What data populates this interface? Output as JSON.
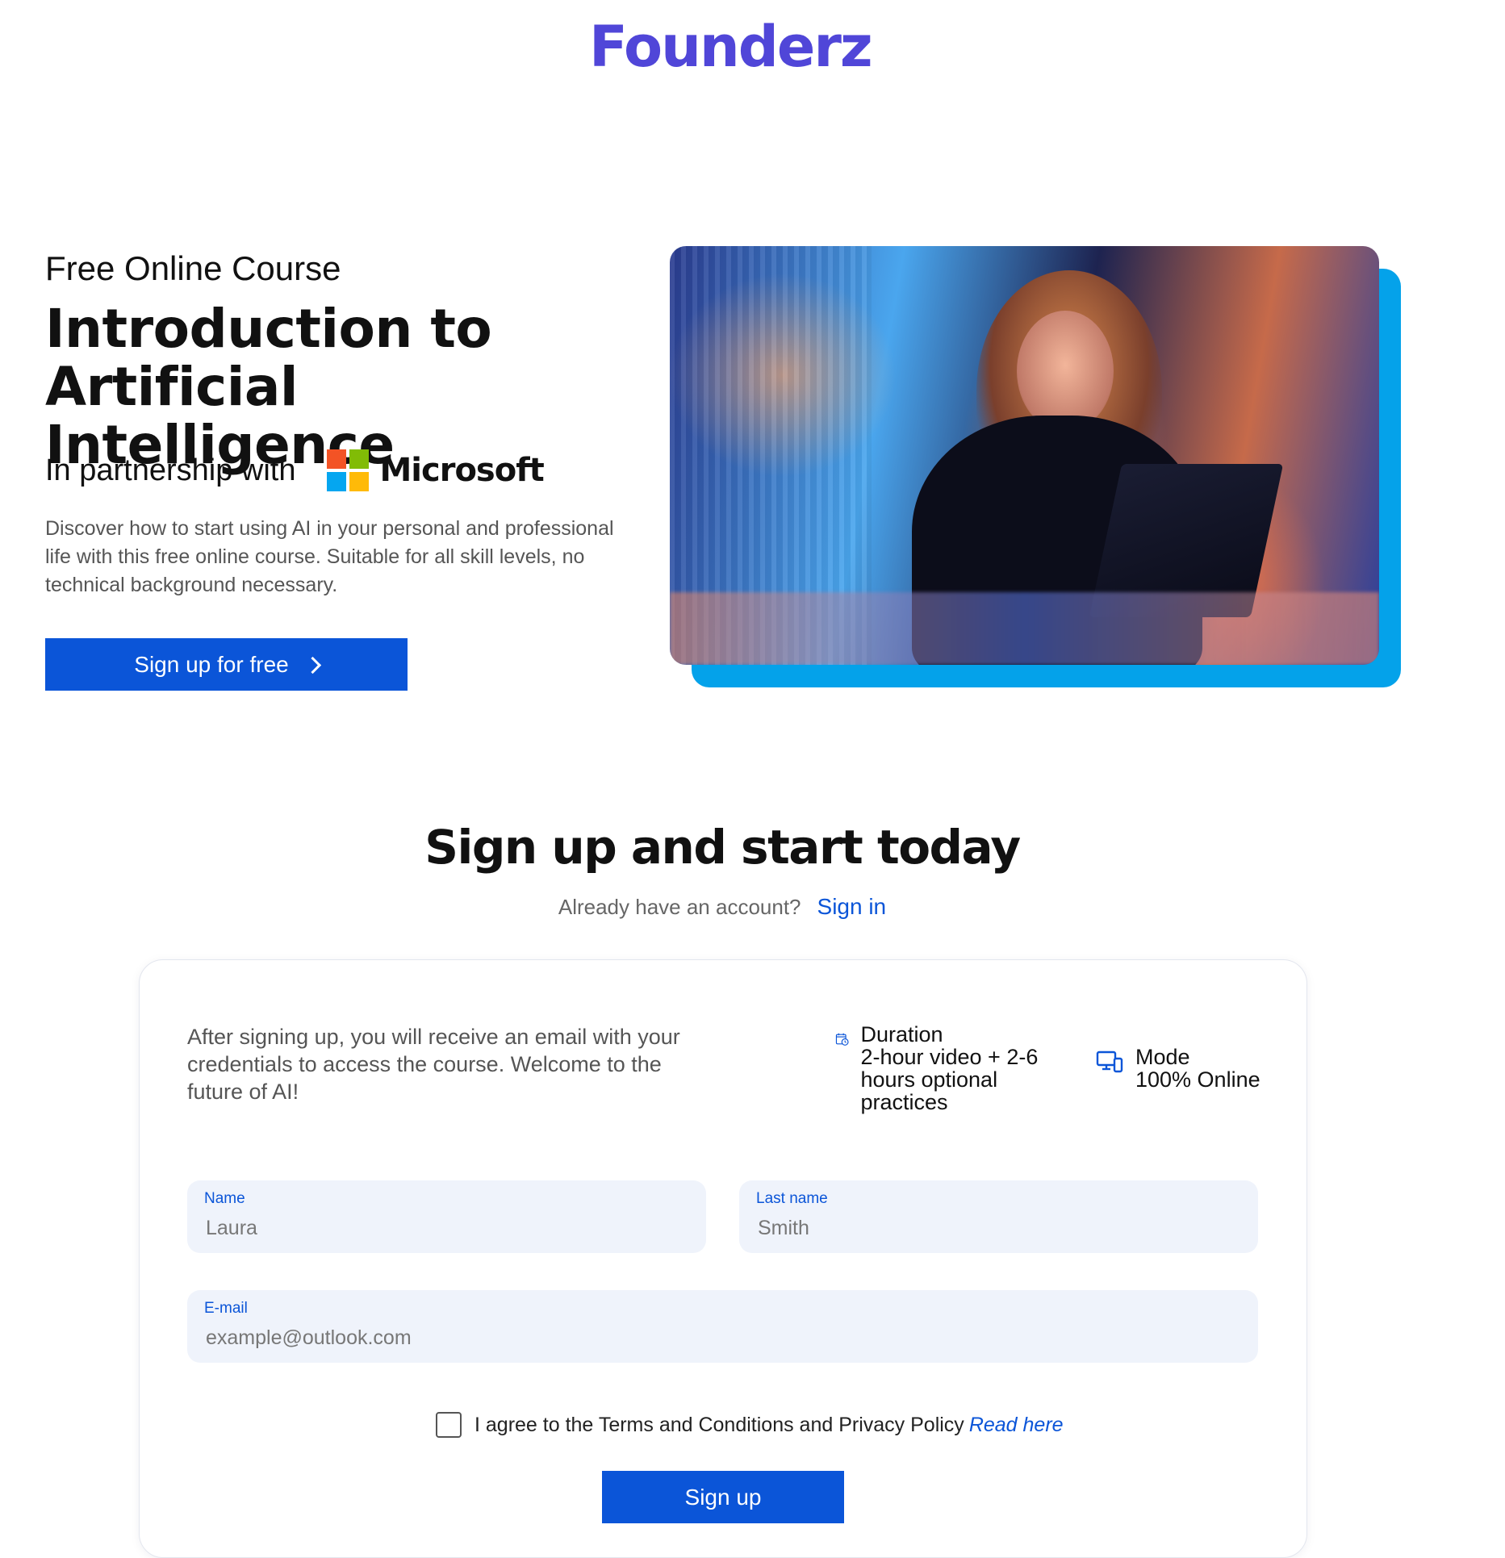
{
  "header": {
    "logo_text": "Founderz"
  },
  "hero": {
    "eyebrow": "Free Online Course",
    "title_line1": "Introduction to",
    "title_line2": "Artificial Intelligence",
    "partnership_label": "In partnership with",
    "partner_name": "Microsoft",
    "description": "Discover how to start using AI in your personal and professional life with this free online course. Suitable for all skill levels, no technical background necessary.",
    "cta_label": "Sign up for free"
  },
  "signup": {
    "title": "Sign up and start today",
    "account_question": "Already have an account?",
    "signin_label": "Sign in",
    "card_description": "After signing up, you will receive an email with your credentials to access the course. Welcome to the future of AI!",
    "duration": {
      "label": "Duration",
      "value": "2-hour video + 2-6 hours optional practices",
      "icon": "calendar-clock-icon"
    },
    "mode": {
      "label": "Mode",
      "value": "100% Online",
      "icon": "devices-icon"
    },
    "fields": {
      "name": {
        "label": "Name",
        "placeholder": "Laura",
        "value": ""
      },
      "last_name": {
        "label": "Last name",
        "placeholder": "Smith",
        "value": ""
      },
      "email": {
        "label": "E-mail",
        "placeholder": "example@outlook.com",
        "value": ""
      }
    },
    "agree_text": "I agree to the Terms and Conditions and Privacy Policy",
    "read_here_label": "Read here",
    "agree_checked": false,
    "submit_label": "Sign up"
  },
  "colors": {
    "brand": "#5046d8",
    "primary_button": "#0b55d8",
    "image_accent": "#04a2ea",
    "field_bg": "#eff3fb",
    "ms_red": "#f35325",
    "ms_green": "#81bc06",
    "ms_blue": "#05a6f0",
    "ms_yellow": "#ffba08"
  }
}
